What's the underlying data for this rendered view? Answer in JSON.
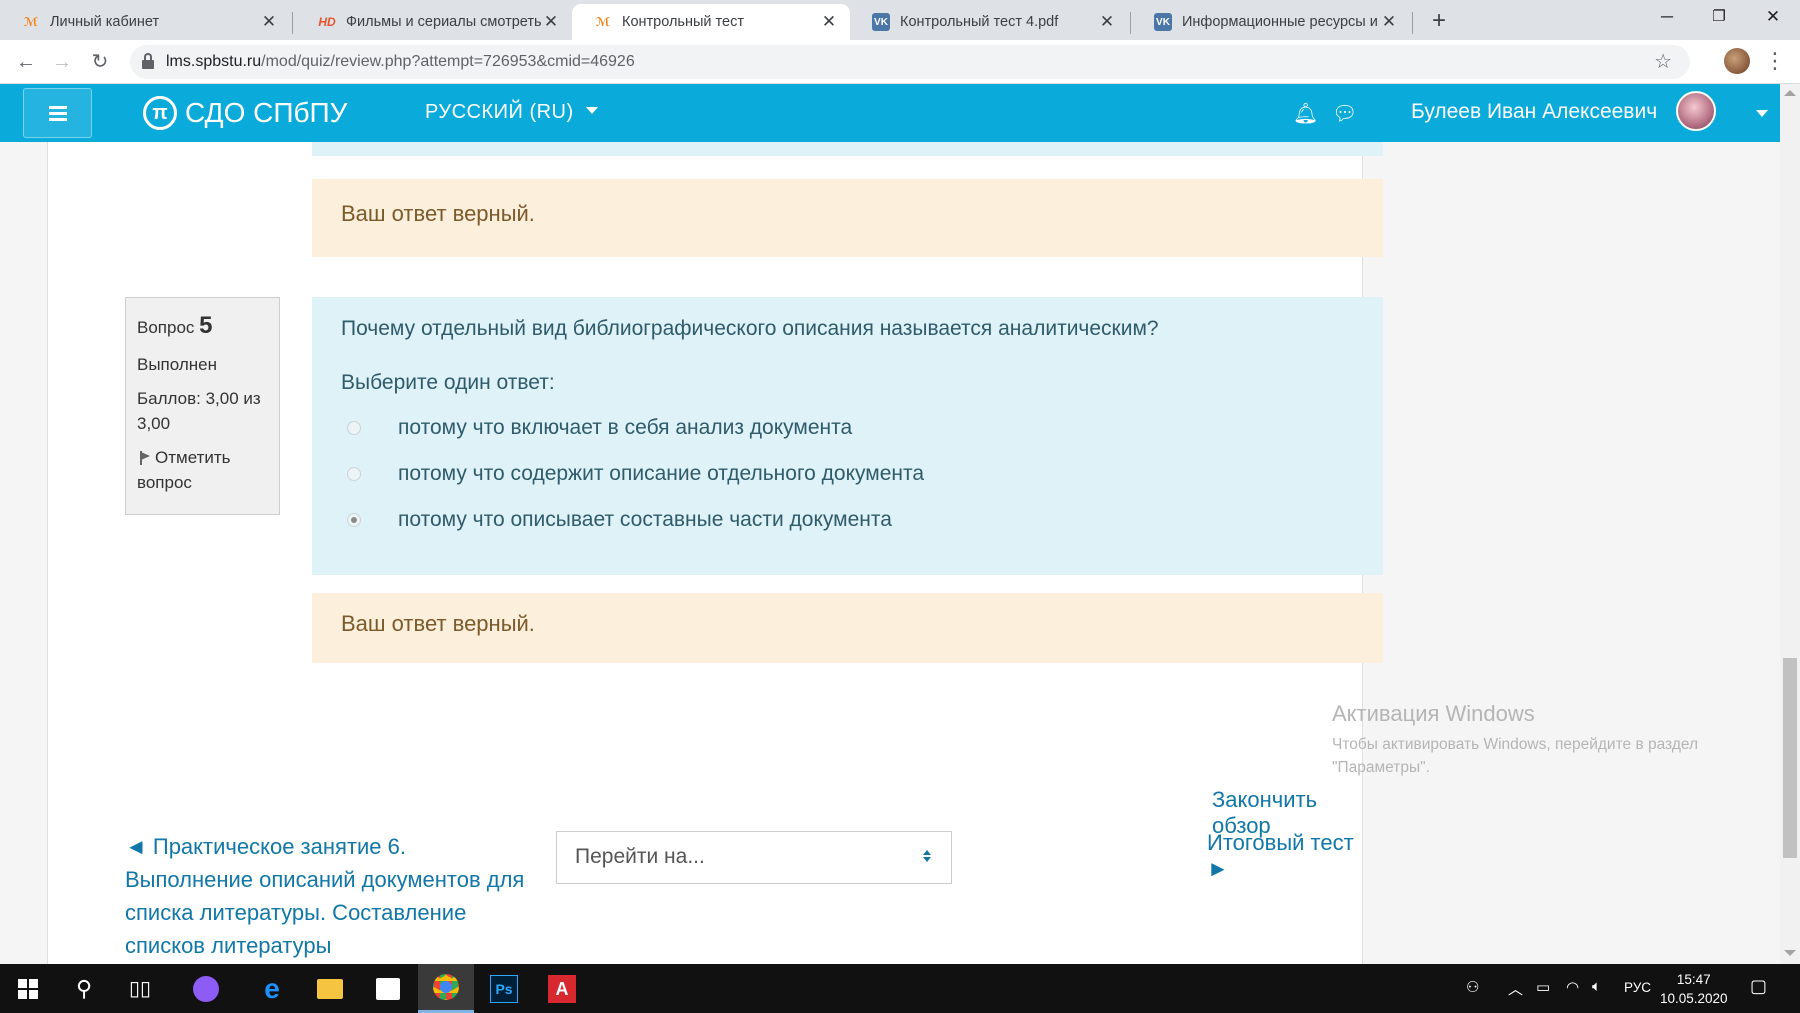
{
  "browser": {
    "tabs": [
      {
        "title": "Личный кабинет",
        "favicon": "moodle-icon",
        "active": false
      },
      {
        "title": "Фильмы и сериалы смотреть он",
        "favicon": "hd-icon",
        "active": false
      },
      {
        "title": "Контрольный тест",
        "favicon": "moodle-icon",
        "active": true
      },
      {
        "title": "Контрольный тест 4.pdf",
        "favicon": "vk-icon",
        "active": false
      },
      {
        "title": "Информационные ресурсы и те",
        "favicon": "vk-icon",
        "active": false
      }
    ],
    "url_host": "lms.spbstu.ru",
    "url_path": "/mod/quiz/review.php?attempt=726953&cmid=46926"
  },
  "navbar": {
    "brand": "СДО СПбПУ",
    "language": "РУССКИЙ (RU)",
    "username": "Булеев Иван Алексеевич",
    "color": "#0aabdb"
  },
  "feedback_top": "Ваш ответ верный.",
  "question": {
    "label": "Вопрос",
    "number": "5",
    "state": "Выполнен",
    "grade": "Баллов: 3,00 из 3,00",
    "flag_label": "Отметить вопрос",
    "text": "Почему отдельный вид библиографического описания называется аналитическим?",
    "prompt": "Выберите один ответ:",
    "answers": [
      {
        "text": "потому что включает в себя анализ документа",
        "selected": false
      },
      {
        "text": "потому что содержит описание отдельного документа",
        "selected": false
      },
      {
        "text": "потому что описывает составные части документа",
        "selected": true
      }
    ],
    "feedback": "Ваш ответ верный."
  },
  "navigation": {
    "finish_review": "Закончить обзор",
    "prev_activity": "◄ Практическое занятие 6. Выполнение описаний документов для списка литературы. Составление списков литературы",
    "jump_placeholder": "Перейти на...",
    "next_activity": "Итоговый тест ►"
  },
  "watermark": {
    "title": "Активация Windows",
    "text": "Чтобы активировать Windows, перейдите в раздел \"Параметры\"."
  },
  "taskbar": {
    "language": "РУС",
    "time": "15:47",
    "date": "10.05.2020"
  }
}
